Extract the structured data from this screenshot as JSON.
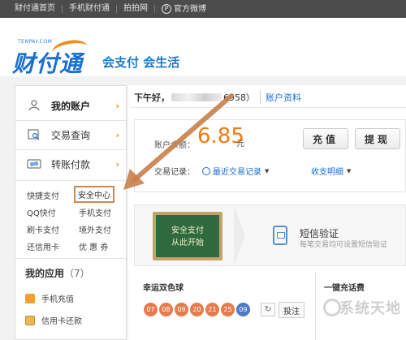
{
  "topbar": {
    "links": [
      "财付通首页",
      "手机财付通",
      "拍拍网",
      "官方微博"
    ]
  },
  "logo": {
    "small_text": "TENPAY.COM",
    "main_text": "财付通",
    "slogan": "会支付 会生活"
  },
  "sidebar": {
    "items": [
      {
        "label": "我的账户",
        "icon": "user-icon"
      },
      {
        "label": "交易查询",
        "icon": "search-list-icon"
      },
      {
        "label": "转账付款",
        "icon": "transfer-icon"
      }
    ],
    "grid_links": [
      "快捷支付",
      "安全中心",
      "QQ快付",
      "手机支付",
      "刷卡支付",
      "境外支付",
      "还信用卡",
      "优 惠 券"
    ],
    "apps_title": "我的应用",
    "apps_count": "（7）",
    "apps": [
      {
        "label": "手机充值",
        "icon": "phone-recharge-icon",
        "color": "#f0a030"
      },
      {
        "label": "信用卡还款",
        "icon": "credit-card-icon",
        "color": "#e8b85a"
      }
    ]
  },
  "main": {
    "greeting_prefix": "下午好，",
    "greeting_suffix": "6958）",
    "account_link": "账户资料",
    "balance_label": "账户余额：",
    "balance_value": "6.85",
    "balance_unit": "元",
    "recharge_button": "充值",
    "withdraw_button": "提现",
    "records_label": "交易记录：",
    "recent_records": "最近交易记录",
    "income_detail": "收支明细",
    "promo": {
      "chalkboard_line1": "安全支付",
      "chalkboard_line2": "从此开始",
      "sms_title": "短信验证",
      "sms_desc": "每笔交易均可设置短信验证"
    },
    "lottery_title": "幸运双色球",
    "balls": [
      "07",
      "08",
      "09",
      "20",
      "21",
      "25",
      "09"
    ],
    "bet_label": "投注",
    "phone_recharge_title": "一键充话费",
    "watermark": "系统天地"
  },
  "colors": {
    "accent_orange": "#f07b14",
    "link_blue": "#1a6fd0",
    "arrow": "#c8804a"
  }
}
